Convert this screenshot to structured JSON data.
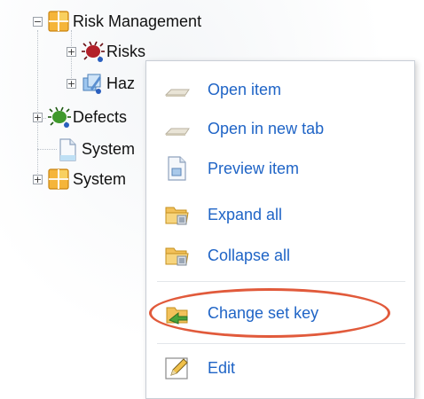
{
  "tree": {
    "items": [
      {
        "label": "Risk Management",
        "expander": "−"
      },
      {
        "label": "Risks",
        "expander": "+"
      },
      {
        "label": "Haz",
        "expander": "+"
      },
      {
        "label": "Defects",
        "expander": "+"
      },
      {
        "label": "System",
        "expander": ""
      },
      {
        "label": "System",
        "expander": "+"
      }
    ]
  },
  "menu": {
    "items": [
      {
        "label": "Open item",
        "icon": "folder-flat-icon"
      },
      {
        "label": "Open in new tab",
        "icon": "folder-flat-icon"
      },
      {
        "label": "Preview item",
        "icon": "document-preview-icon"
      },
      {
        "label": "Expand all",
        "icon": "folder-expand-icon"
      },
      {
        "label": "Collapse all",
        "icon": "folder-collapse-icon"
      },
      {
        "label": "Change set key",
        "icon": "key-folder-icon"
      },
      {
        "label": "Edit",
        "icon": "pencil-edit-icon"
      }
    ]
  },
  "colors": {
    "menu_text": "#1f64c6",
    "highlight": "#e15a3b"
  }
}
